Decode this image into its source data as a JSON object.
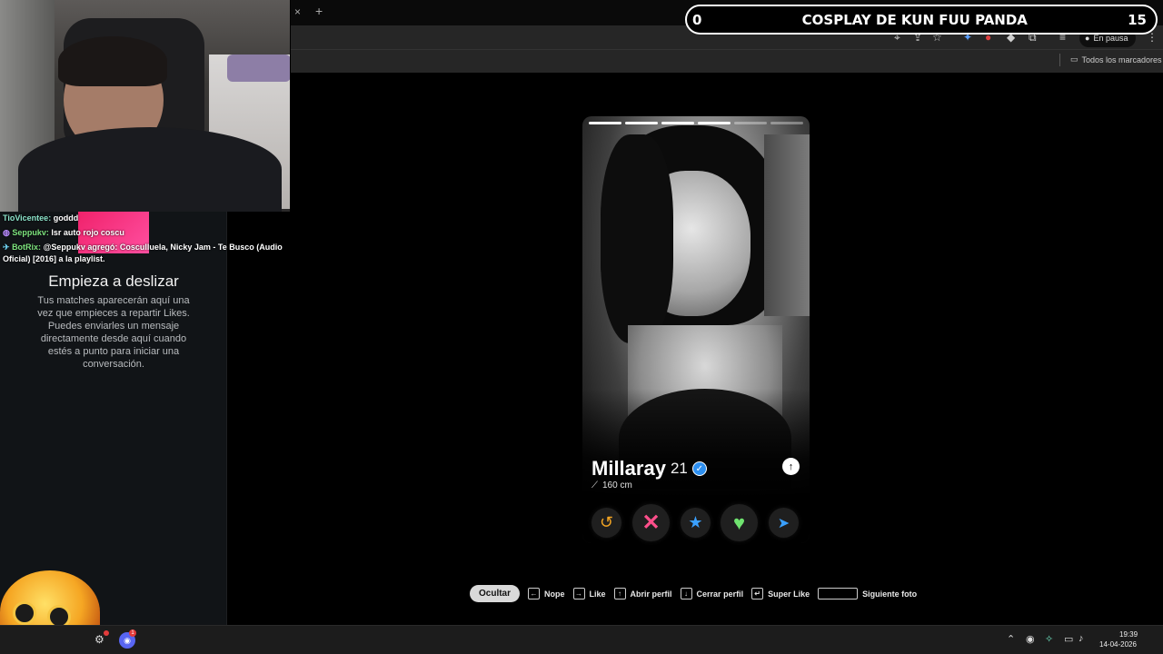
{
  "browser": {
    "tab_close": "×",
    "tab_new": "+",
    "pause_label": "En pausa",
    "all_bookmarks": "Todos los marcadores"
  },
  "banner": {
    "left_value": "0",
    "title": "COSPLAY DE KUN FUU PANDA",
    "right_value": "15"
  },
  "chat": {
    "lines": [
      {
        "user": "TioVicentee:",
        "message": "goddd"
      },
      {
        "user": "Seppukv:",
        "message": "lsr auto rojo coscu"
      },
      {
        "user": "BotRix:",
        "message": "@Seppukv agregó: Cosculluela, Nicky Jam - Te Busco (Audio Oficial) [2016] a la playlist."
      }
    ]
  },
  "sidebar": {
    "title": "Empieza a deslizar",
    "text": "Tus matches aparecerán aquí una vez que empieces a repartir Likes. Puedes enviarles un mensaje directamente desde aquí cuando estés a punto para iniciar una conversación."
  },
  "profile": {
    "name": "Millaray",
    "age": "21",
    "height": "160 cm",
    "photo_count": 6,
    "active_photo": 4
  },
  "shortcuts": {
    "hide": "Ocultar",
    "nope": "Nope",
    "like": "Like",
    "open_profile": "Abrir perfil",
    "close_profile": "Cerrar perfil",
    "super_like": "Super Like",
    "next_photo": "Siguiente foto"
  },
  "taskbar": {
    "time": "19:39",
    "date": "14-04-2026",
    "discord_badge": "1"
  },
  "colors": {
    "rewind": "#f5a623",
    "nope": "#ff4f8b",
    "superlike": "#3aa0ff",
    "like": "#6fe36f",
    "boost": "#3aa0ff",
    "verified": "#2d8ff0"
  }
}
